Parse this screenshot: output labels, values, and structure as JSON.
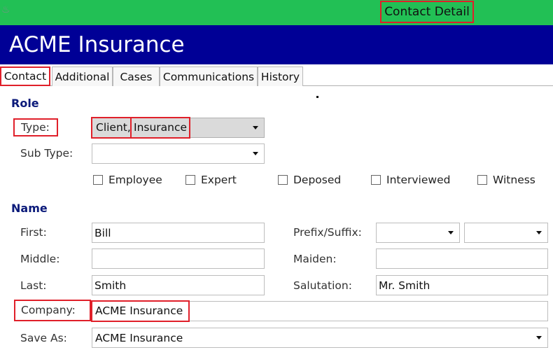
{
  "window": {
    "app_icon": "app-icon",
    "title": "Contact Detail"
  },
  "banner": {
    "title": "ACME Insurance"
  },
  "tabs": [
    {
      "label": "Contact",
      "active": true
    },
    {
      "label": "Additional"
    },
    {
      "label": "Cases"
    },
    {
      "label": "Communications"
    },
    {
      "label": "History"
    }
  ],
  "role": {
    "section": "Role",
    "type_label": "Type:",
    "type_values": [
      "Client,",
      "Insurance"
    ],
    "subtype_label": "Sub Type:",
    "subtype_value": "",
    "checkboxes": [
      {
        "label": "Employee",
        "checked": false
      },
      {
        "label": "Expert",
        "checked": false
      },
      {
        "label": "Deposed",
        "checked": false
      },
      {
        "label": "Interviewed",
        "checked": false
      },
      {
        "label": "Witness",
        "checked": false
      }
    ]
  },
  "name": {
    "section": "Name",
    "first_label": "First:",
    "first_value": "Bill",
    "middle_label": "Middle:",
    "middle_value": "",
    "last_label": "Last:",
    "last_value": "Smith",
    "prefix_suffix_label": "Prefix/Suffix:",
    "prefix_value": "",
    "suffix_value": "",
    "maiden_label": "Maiden:",
    "maiden_value": "",
    "salutation_label": "Salutation:",
    "salutation_value": "Mr. Smith",
    "company_label": "Company:",
    "company_value": "ACME Insurance",
    "saveas_label": "Save As:",
    "saveas_value": "ACME Insurance"
  },
  "colors": {
    "titlebar": "#22c055",
    "banner": "#000096",
    "section": "#0b1a7a",
    "highlight": "#e0202a"
  }
}
